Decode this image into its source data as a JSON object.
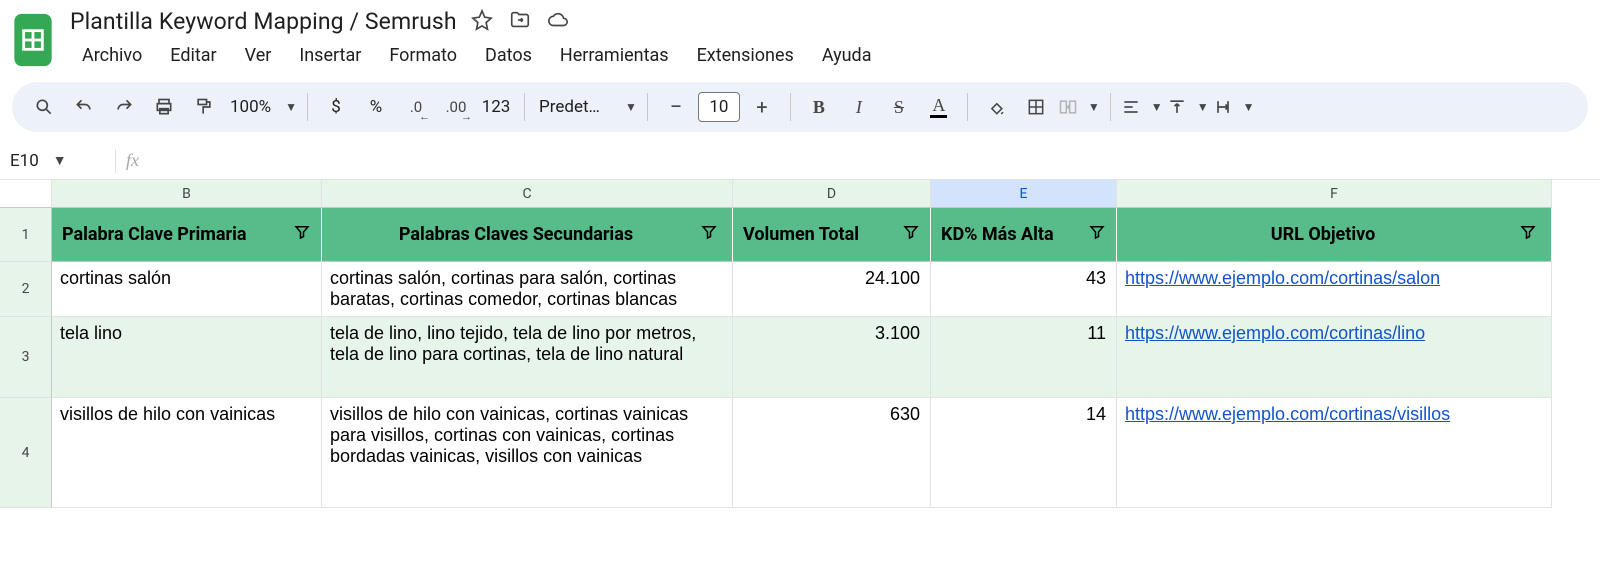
{
  "doc": {
    "title": "Plantilla Keyword Mapping / Semrush"
  },
  "menus": [
    "Archivo",
    "Editar",
    "Ver",
    "Insertar",
    "Formato",
    "Datos",
    "Herramientas",
    "Extensiones",
    "Ayuda"
  ],
  "toolbar": {
    "zoom": "100%",
    "currency": "$",
    "percent": "%",
    "dec_dec": ".0",
    "inc_dec": ".00",
    "num_fmt": "123",
    "font": "Predet…",
    "font_size": "10"
  },
  "name_box": "E10",
  "columns": [
    "B",
    "C",
    "D",
    "E",
    "F"
  ],
  "headers": {
    "B": "Palabra Clave Primaria",
    "C": "Palabras Claves Secundarias",
    "D": "Volumen Total",
    "E": "KD% Más Alta",
    "F": "URL Objetivo"
  },
  "rows": [
    {
      "n": "2",
      "B": "cortinas salón",
      "C": "cortinas salón, cortinas para salón, cortinas baratas, cortinas comedor, cortinas blancas",
      "D": "24.100",
      "E": "43",
      "F": "https://www.ejemplo.com/cortinas/salon"
    },
    {
      "n": "3",
      "B": "tela lino",
      "C": "tela de lino, lino tejido, tela de lino por metros, tela de lino para cortinas, tela de lino natural",
      "D": "3.100",
      "E": "11",
      "F": "https://www.ejemplo.com/cortinas/lino"
    },
    {
      "n": "4",
      "B": "visillos de hilo con vainicas",
      "C": "visillos de hilo con vainicas, cortinas vainicas para visillos, cortinas con vainicas, cortinas bordadas vainicas, visillos con vainicas",
      "D": "630",
      "E": "14",
      "F": "https://www.ejemplo.com/cortinas/visillos"
    }
  ]
}
